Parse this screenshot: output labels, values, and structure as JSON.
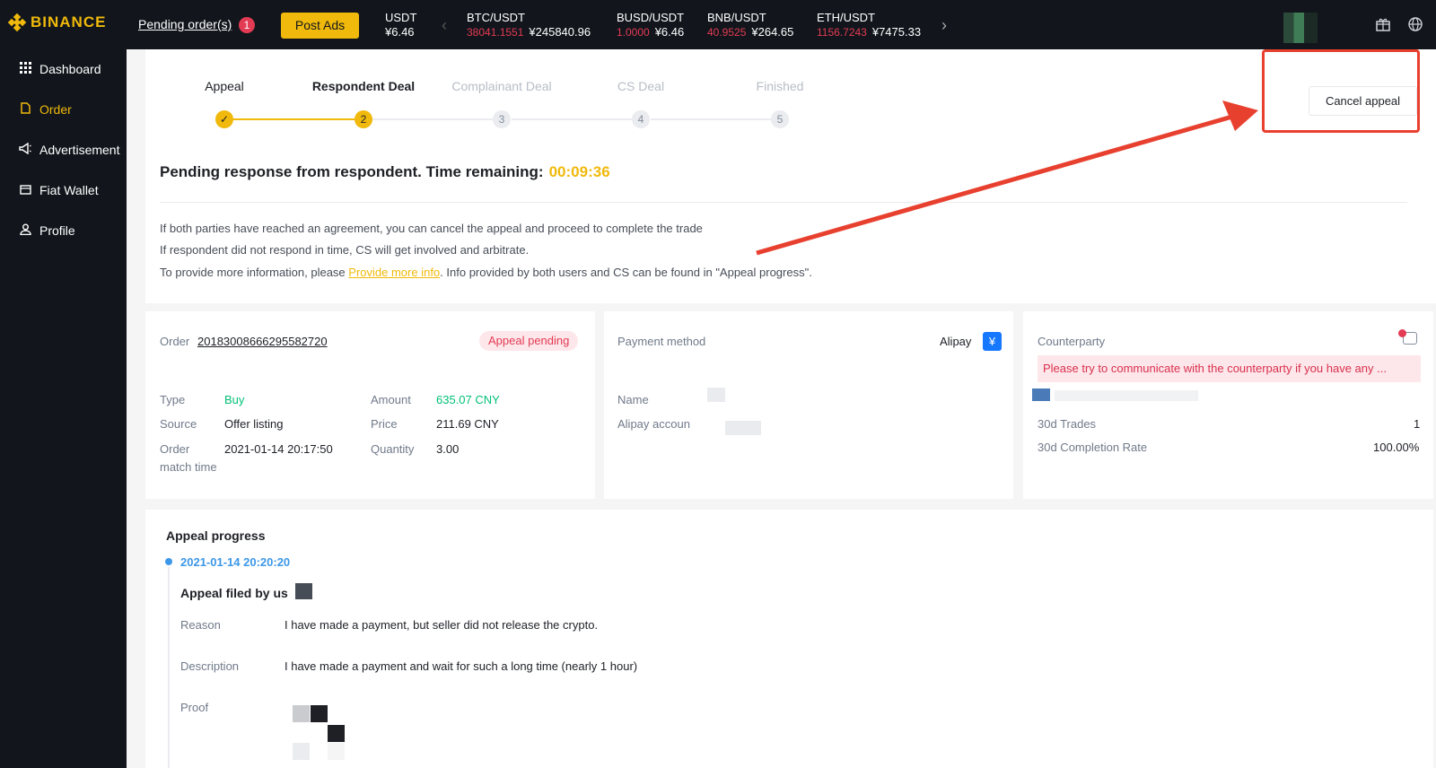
{
  "header": {
    "brand": "BINANCE",
    "pending_orders": "Pending order(s)",
    "pending_count": "1",
    "post_ads": "Post Ads",
    "tickers": [
      {
        "pair": "USDT",
        "change": "",
        "price": "¥6.46"
      },
      {
        "pair": "BTC/USDT",
        "change": "38041.1551",
        "price": "¥245840.96"
      },
      {
        "pair": "BUSD/USDT",
        "change": "1.0000",
        "price": "¥6.46"
      },
      {
        "pair": "BNB/USDT",
        "change": "40.9525",
        "price": "¥264.65"
      },
      {
        "pair": "ETH/USDT",
        "change": "1156.7243",
        "price": "¥7475.33"
      }
    ],
    "icons": [
      "chevron-left-icon",
      "chevron-right-icon",
      "gift-icon",
      "globe-icon"
    ]
  },
  "sidebar": {
    "items": [
      {
        "label": "Dashboard",
        "icon": "grid-icon"
      },
      {
        "label": "Order",
        "icon": "document-icon",
        "active": true
      },
      {
        "label": "Advertisement",
        "icon": "megaphone-icon"
      },
      {
        "label": "Fiat Wallet",
        "icon": "wallet-icon"
      },
      {
        "label": "Profile",
        "icon": "user-icon"
      }
    ]
  },
  "steps": [
    {
      "label": "Appeal",
      "marker": "✓",
      "state": "done"
    },
    {
      "label": "Respondent Deal",
      "marker": "2",
      "state": "current"
    },
    {
      "label": "Complainant Deal",
      "marker": "3",
      "state": "todo"
    },
    {
      "label": "CS Deal",
      "marker": "4",
      "state": "todo"
    },
    {
      "label": "Finished",
      "marker": "5",
      "state": "todo"
    }
  ],
  "cancel_appeal": "Cancel appeal",
  "status": {
    "title": "Pending response from respondent. Time remaining:",
    "timer": "00:09:36",
    "line1": "If both parties have reached an agreement, you can cancel the appeal and proceed to complete the trade",
    "line2": "If respondent did not respond in time, CS will get involved and arbitrate.",
    "line3_pre": "To provide more information, please ",
    "line3_link": "Provide more info",
    "line3_post": ". Info provided by both users and CS can be found in \"Appeal progress\"."
  },
  "order": {
    "order_label": "Order",
    "order_number": "20183008666295582720",
    "status_badge": "Appeal pending",
    "type_label": "Type",
    "type_value": "Buy",
    "source_label": "Source",
    "source_value": "Offer listing",
    "match_label_1": "Order",
    "match_label_2": "match time",
    "match_value": "2021-01-14 20:17:50",
    "amount_label": "Amount",
    "amount_value": "635.07 CNY",
    "price_label": "Price",
    "price_value": "211.69 CNY",
    "quantity_label": "Quantity",
    "quantity_value": "3.00"
  },
  "payment": {
    "label": "Payment method",
    "method": "Alipay",
    "method_icon": "¥",
    "name_label": "Name",
    "account_label": "Alipay accoun"
  },
  "counterparty": {
    "label": "Counterparty",
    "notice_count": "1",
    "warning": "Please try to communicate with the counterparty if you have any ...",
    "trades_label": "30d Trades",
    "trades_value": "1",
    "completion_label": "30d Completion Rate",
    "completion_value": "100.00%"
  },
  "appeal_progress": {
    "title": "Appeal progress",
    "date": "2021-01-14 20:20:20",
    "heading": "Appeal filed by us",
    "reason_label": "Reason",
    "reason_value": "I have made a payment, but seller did not release the crypto.",
    "description_label": "Description",
    "description_value": "I have made a payment and wait for such a long time (nearly 1 hour)",
    "proof_label": "Proof"
  },
  "colors": {
    "brand": "#f0b90b",
    "annotation": "#e8402f",
    "danger": "#e33b54",
    "success": "#02c076",
    "link": "#3c97e8"
  }
}
